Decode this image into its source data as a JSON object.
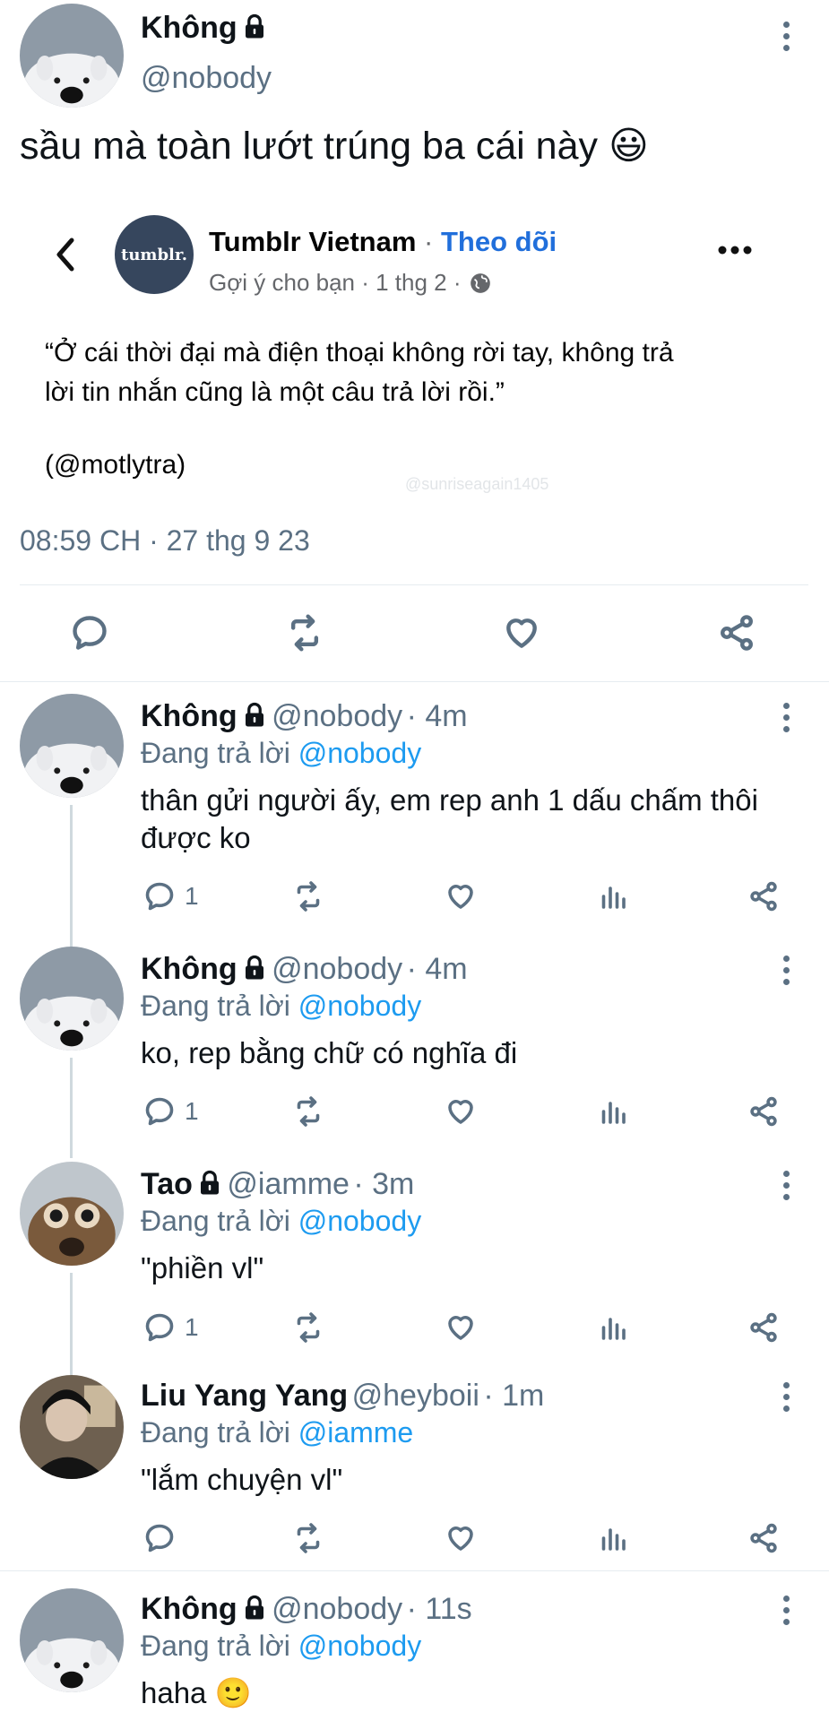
{
  "main_post": {
    "name": "Không",
    "handle": "@nobody",
    "text": "sầu mà toàn lướt trúng ba cái này 😃",
    "timestamp": "08:59 CH · 27 thg 9 23"
  },
  "embedded": {
    "logo_text": "tumblr.",
    "page_name": "Tumblr Vietnam",
    "separator": " · ",
    "follow_label": "Theo dõi",
    "meta": "Gợi ý cho bạn · 1 thg 2 ·",
    "quote_line1": "“Ở cái thời đại mà điện thoại không rời tay, không trả",
    "quote_line2": "lời tin nhắn cũng là một câu trả lời rồi.”",
    "credit": "(@motlytra)",
    "watermark": "@sunriseagain1405"
  },
  "reply_prefix": "Đang trả lời",
  "replies": [
    {
      "name": "Không",
      "handle": "@nobody",
      "time": "· 4m",
      "mention": "@nobody",
      "line1": "thân gửi người ấy, em rep anh 1 dấu chấm thôi",
      "line2": "được ko",
      "reply_count": "1"
    },
    {
      "name": "Không",
      "handle": "@nobody",
      "time": "· 4m",
      "mention": "@nobody",
      "line1": "ko, rep bằng chữ có nghĩa đi",
      "reply_count": "1"
    },
    {
      "name": "Tao",
      "handle": "@iamme",
      "time": "· 3m",
      "mention": "@nobody",
      "line1": "\"phiền vl\"",
      "reply_count": "1"
    },
    {
      "name": "Liu Yang Yang",
      "handle": "@heyboii",
      "time": "· 1m",
      "mention": "@iamme",
      "line1": "\"lắm chuyện vl\"",
      "reply_count": ""
    },
    {
      "name": "Không",
      "handle": "@nobody",
      "time": "· 11s",
      "mention": "@nobody",
      "line1": "haha 🙂"
    }
  ],
  "icons": {
    "reply": "reply-icon",
    "retweet": "retweet-icon",
    "like": "heart-icon",
    "views": "analytics-icon",
    "share": "share-icon",
    "lock": "lock-icon",
    "more": "kebab-icon"
  },
  "colors": {
    "link": "#1d9bf0",
    "muted": "#5b7083",
    "tumblr_blue": "#36465d"
  }
}
